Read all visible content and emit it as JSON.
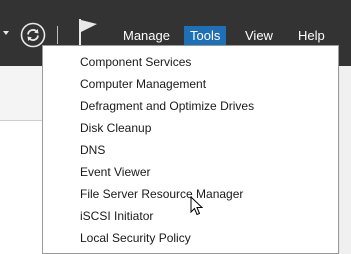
{
  "toolbar": {
    "refresh_icon": "refresh-icon",
    "flag_icon": "notifications-flag-icon",
    "dropdown_arrow_icon": "chevron-down-icon"
  },
  "menu": {
    "items": [
      "Manage",
      "Tools",
      "View",
      "Help"
    ],
    "active": "Tools",
    "active_color": "#1f6fb5",
    "bar_color": "#333333"
  },
  "tools_menu": {
    "items": [
      "Component Services",
      "Computer Management",
      "Defragment and Optimize Drives",
      "Disk Cleanup",
      "DNS",
      "Event Viewer",
      "File Server Resource Manager",
      "iSCSI Initiator",
      "Local Security Policy"
    ]
  }
}
